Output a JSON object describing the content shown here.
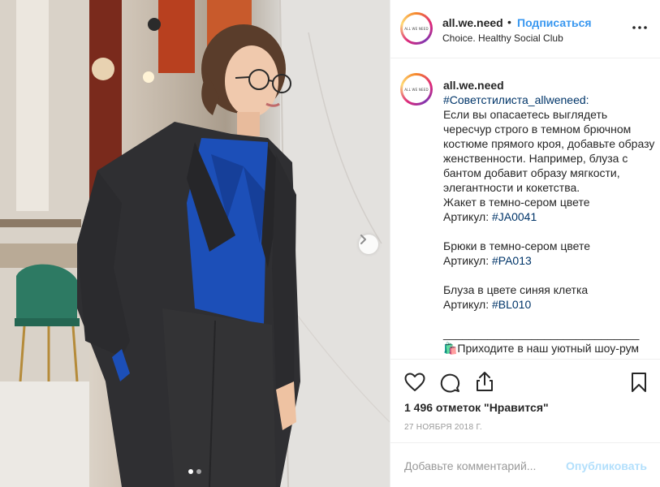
{
  "post": {
    "username": "all.we.need",
    "separator": "•",
    "follow_label": "Подписаться",
    "location": "Choice. Healthy Social Club",
    "avatar_text": "ALL WE NEED",
    "more_icon": "more-horizontal-icon"
  },
  "caption": {
    "username": "all.we.need",
    "hashtag": "#Советстилиста_allweneed:",
    "paragraph": "Если вы опасаетесь выглядеть чересчур строго в темном брючном костюме прямого кроя, добавьте образу женственности. Например, блуза с бантом добавит образу мягкости, элегантности и кокетства.",
    "item1_name": "Жакет в темно-сером цвете",
    "item1_prefix": "Артикул: ",
    "item1_code": "#JA0041",
    "item2_name": "Брюки в темно-сером цвете",
    "item2_prefix": "Артикул: ",
    "item2_code": "#PA013",
    "item3_name": "Блуза в цвете синяя клетка",
    "item3_prefix": "Артикул: ",
    "item3_code": "#BL010",
    "divider": "_______________________________",
    "cta": "🛍️Приходите в наш уютный шоу-рум"
  },
  "actions": {
    "like_icon": "heart-icon",
    "comment_icon": "comment-icon",
    "share_icon": "share-icon",
    "save_icon": "bookmark-icon",
    "likes_text": "1 496 отметок \"Нравится\"",
    "date_text": "27 НОЯБРЯ 2018 Г."
  },
  "comment": {
    "placeholder": "Добавьте комментарий...",
    "publish_label": "Опубликовать"
  },
  "carousel": {
    "current_index": 1,
    "total": 2
  },
  "colors": {
    "link_blue": "#3897f0",
    "hashtag_blue": "#003569",
    "publish_disabled": "#b2dffc",
    "muted": "#999999",
    "border": "#efefef"
  }
}
